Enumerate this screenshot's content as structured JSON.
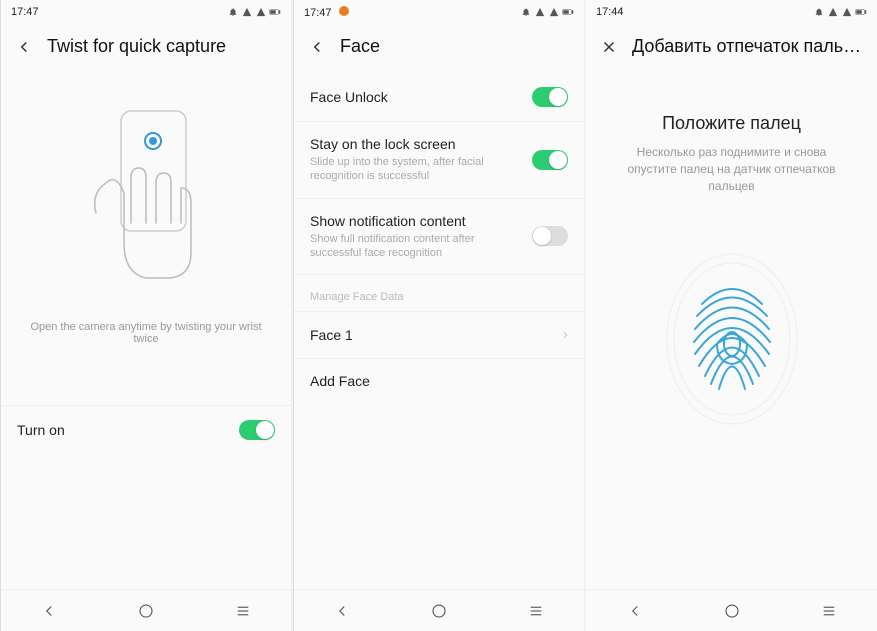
{
  "screen1": {
    "time": "17:47",
    "title": "Twist for quick capture",
    "description": "Open the camera anytime by twisting your wrist twice",
    "toggle": {
      "label": "Turn on",
      "on": true
    }
  },
  "screen2": {
    "time": "17:47",
    "title": "Face",
    "faceUnlock": {
      "label": "Face Unlock",
      "on": true
    },
    "stayLock": {
      "label": "Stay on the lock screen",
      "sub": "Slide up into the system, after facial recognition is successful",
      "on": true
    },
    "showNotif": {
      "label": "Show notification content",
      "sub": "Show full notification content after successful face recognition",
      "on": false
    },
    "sectionHeader": "Manage Face Data",
    "face1": "Face 1",
    "addFace": "Add Face"
  },
  "screen3": {
    "time": "17:44",
    "title": "Добавить отпечаток паль…",
    "heading": "Положите палец",
    "sub": "Несколько раз поднимите и снова опустите палец на датчик отпечатков пальцев"
  }
}
